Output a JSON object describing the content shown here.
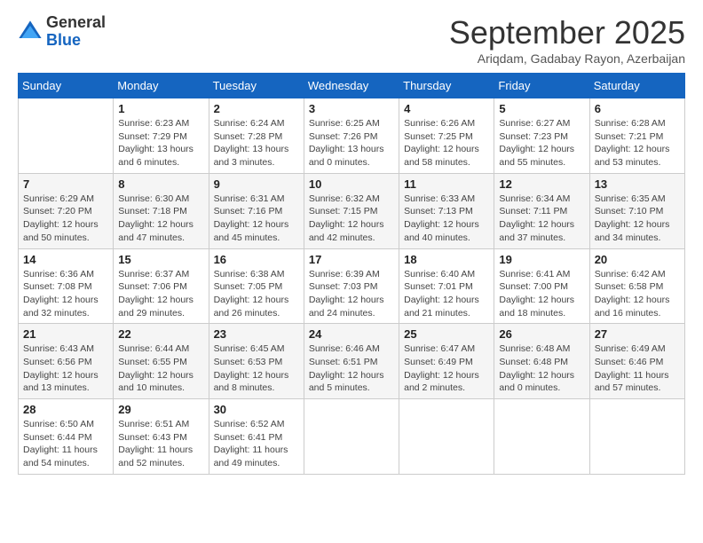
{
  "header": {
    "logo_line1": "General",
    "logo_line2": "Blue",
    "month": "September 2025",
    "location": "Ariqdam, Gadabay Rayon, Azerbaijan"
  },
  "days_of_week": [
    "Sunday",
    "Monday",
    "Tuesday",
    "Wednesday",
    "Thursday",
    "Friday",
    "Saturday"
  ],
  "weeks": [
    [
      {
        "day": "",
        "info": ""
      },
      {
        "day": "1",
        "info": "Sunrise: 6:23 AM\nSunset: 7:29 PM\nDaylight: 13 hours\nand 6 minutes."
      },
      {
        "day": "2",
        "info": "Sunrise: 6:24 AM\nSunset: 7:28 PM\nDaylight: 13 hours\nand 3 minutes."
      },
      {
        "day": "3",
        "info": "Sunrise: 6:25 AM\nSunset: 7:26 PM\nDaylight: 13 hours\nand 0 minutes."
      },
      {
        "day": "4",
        "info": "Sunrise: 6:26 AM\nSunset: 7:25 PM\nDaylight: 12 hours\nand 58 minutes."
      },
      {
        "day": "5",
        "info": "Sunrise: 6:27 AM\nSunset: 7:23 PM\nDaylight: 12 hours\nand 55 minutes."
      },
      {
        "day": "6",
        "info": "Sunrise: 6:28 AM\nSunset: 7:21 PM\nDaylight: 12 hours\nand 53 minutes."
      }
    ],
    [
      {
        "day": "7",
        "info": "Sunrise: 6:29 AM\nSunset: 7:20 PM\nDaylight: 12 hours\nand 50 minutes."
      },
      {
        "day": "8",
        "info": "Sunrise: 6:30 AM\nSunset: 7:18 PM\nDaylight: 12 hours\nand 47 minutes."
      },
      {
        "day": "9",
        "info": "Sunrise: 6:31 AM\nSunset: 7:16 PM\nDaylight: 12 hours\nand 45 minutes."
      },
      {
        "day": "10",
        "info": "Sunrise: 6:32 AM\nSunset: 7:15 PM\nDaylight: 12 hours\nand 42 minutes."
      },
      {
        "day": "11",
        "info": "Sunrise: 6:33 AM\nSunset: 7:13 PM\nDaylight: 12 hours\nand 40 minutes."
      },
      {
        "day": "12",
        "info": "Sunrise: 6:34 AM\nSunset: 7:11 PM\nDaylight: 12 hours\nand 37 minutes."
      },
      {
        "day": "13",
        "info": "Sunrise: 6:35 AM\nSunset: 7:10 PM\nDaylight: 12 hours\nand 34 minutes."
      }
    ],
    [
      {
        "day": "14",
        "info": "Sunrise: 6:36 AM\nSunset: 7:08 PM\nDaylight: 12 hours\nand 32 minutes."
      },
      {
        "day": "15",
        "info": "Sunrise: 6:37 AM\nSunset: 7:06 PM\nDaylight: 12 hours\nand 29 minutes."
      },
      {
        "day": "16",
        "info": "Sunrise: 6:38 AM\nSunset: 7:05 PM\nDaylight: 12 hours\nand 26 minutes."
      },
      {
        "day": "17",
        "info": "Sunrise: 6:39 AM\nSunset: 7:03 PM\nDaylight: 12 hours\nand 24 minutes."
      },
      {
        "day": "18",
        "info": "Sunrise: 6:40 AM\nSunset: 7:01 PM\nDaylight: 12 hours\nand 21 minutes."
      },
      {
        "day": "19",
        "info": "Sunrise: 6:41 AM\nSunset: 7:00 PM\nDaylight: 12 hours\nand 18 minutes."
      },
      {
        "day": "20",
        "info": "Sunrise: 6:42 AM\nSunset: 6:58 PM\nDaylight: 12 hours\nand 16 minutes."
      }
    ],
    [
      {
        "day": "21",
        "info": "Sunrise: 6:43 AM\nSunset: 6:56 PM\nDaylight: 12 hours\nand 13 minutes."
      },
      {
        "day": "22",
        "info": "Sunrise: 6:44 AM\nSunset: 6:55 PM\nDaylight: 12 hours\nand 10 minutes."
      },
      {
        "day": "23",
        "info": "Sunrise: 6:45 AM\nSunset: 6:53 PM\nDaylight: 12 hours\nand 8 minutes."
      },
      {
        "day": "24",
        "info": "Sunrise: 6:46 AM\nSunset: 6:51 PM\nDaylight: 12 hours\nand 5 minutes."
      },
      {
        "day": "25",
        "info": "Sunrise: 6:47 AM\nSunset: 6:49 PM\nDaylight: 12 hours\nand 2 minutes."
      },
      {
        "day": "26",
        "info": "Sunrise: 6:48 AM\nSunset: 6:48 PM\nDaylight: 12 hours\nand 0 minutes."
      },
      {
        "day": "27",
        "info": "Sunrise: 6:49 AM\nSunset: 6:46 PM\nDaylight: 11 hours\nand 57 minutes."
      }
    ],
    [
      {
        "day": "28",
        "info": "Sunrise: 6:50 AM\nSunset: 6:44 PM\nDaylight: 11 hours\nand 54 minutes."
      },
      {
        "day": "29",
        "info": "Sunrise: 6:51 AM\nSunset: 6:43 PM\nDaylight: 11 hours\nand 52 minutes."
      },
      {
        "day": "30",
        "info": "Sunrise: 6:52 AM\nSunset: 6:41 PM\nDaylight: 11 hours\nand 49 minutes."
      },
      {
        "day": "",
        "info": ""
      },
      {
        "day": "",
        "info": ""
      },
      {
        "day": "",
        "info": ""
      },
      {
        "day": "",
        "info": ""
      }
    ]
  ]
}
